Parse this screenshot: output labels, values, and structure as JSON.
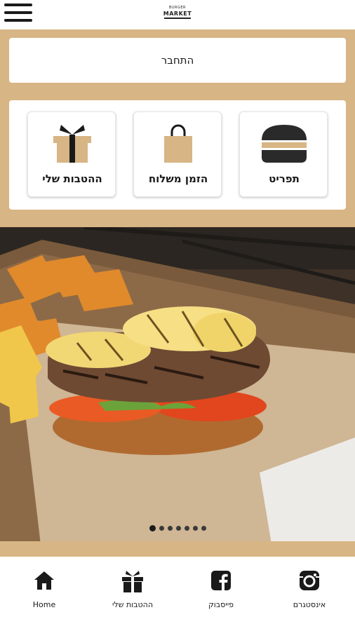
{
  "header": {
    "logo_line1": "BURGER",
    "logo_line2": "MARKET"
  },
  "login_button": "התחבר",
  "tiles": [
    {
      "label": "תפריט",
      "icon": "burger-icon"
    },
    {
      "label": "הזמן משלוח",
      "icon": "shopping-bag-icon"
    },
    {
      "label": "ההטבות שלי",
      "icon": "gift-icon"
    }
  ],
  "carousel": {
    "slide_count": 7,
    "active_index": 0
  },
  "bottom_nav": [
    {
      "label": "Home",
      "icon": "home-icon"
    },
    {
      "label": "ההטבות שלי",
      "icon": "gift-icon"
    },
    {
      "label": "פייסבוק",
      "icon": "facebook-icon"
    },
    {
      "label": "אינסטגרם",
      "icon": "instagram-icon"
    }
  ],
  "colors": {
    "accent_tan": "#d8b585",
    "dark": "#1a1a1a"
  }
}
